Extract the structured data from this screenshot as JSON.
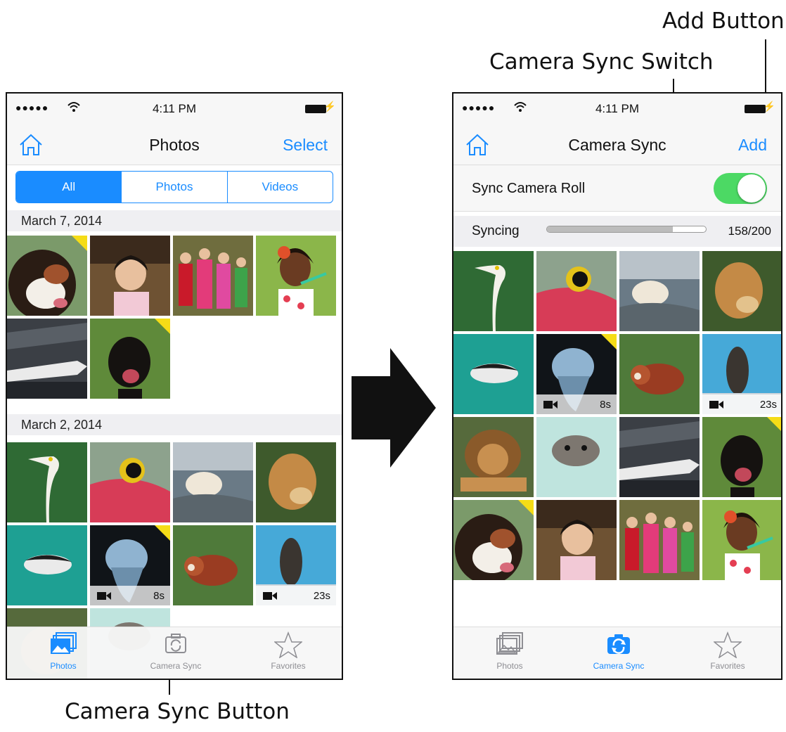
{
  "callouts": {
    "add_button": "Add Button",
    "camera_sync_switch": "Camera Sync Switch",
    "camera_sync_button": "Camera Sync Button"
  },
  "status_bar": {
    "time": "4:11 PM"
  },
  "left_screen": {
    "title": "Photos",
    "action": "Select",
    "segments": [
      {
        "label": "All",
        "selected": true
      },
      {
        "label": "Photos",
        "selected": false
      },
      {
        "label": "Videos",
        "selected": false
      }
    ],
    "sections": [
      {
        "date": "March 7, 2014"
      },
      {
        "date": "March 2, 2014"
      }
    ],
    "video_durations": [
      "8s",
      "23s"
    ]
  },
  "right_screen": {
    "title": "Camera Sync",
    "action": "Add",
    "sync_label": "Sync Camera Roll",
    "sync_enabled": true,
    "syncing_label": "Syncing",
    "progress_text": "158/200",
    "progress_fraction": 0.79,
    "video_durations": [
      "8s",
      "23s"
    ]
  },
  "tabs": [
    {
      "label": "Photos",
      "icon": "photos-icon"
    },
    {
      "label": "Camera Sync",
      "icon": "camera-sync-icon"
    },
    {
      "label": "Favorites",
      "icon": "star-icon"
    }
  ],
  "colors": {
    "accent": "#1a8cff",
    "toggle_on": "#4cd964",
    "section_bg": "#efeff2",
    "corner_flag": "#f5dc17"
  }
}
